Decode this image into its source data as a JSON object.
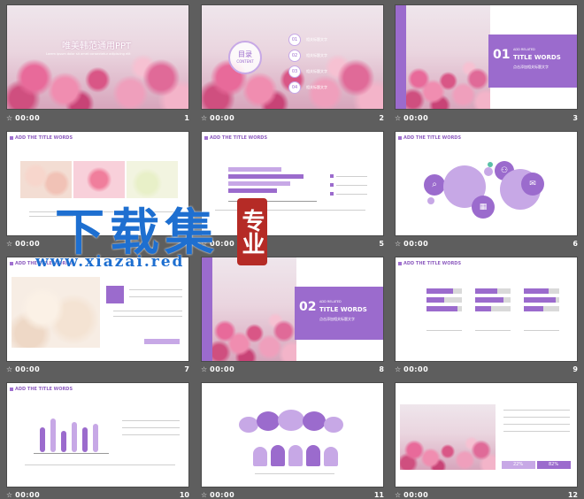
{
  "slides": {
    "s1": {
      "title": "唯美韩范通用PPT",
      "sub": "Lorem ipsum dolor sit amet consectetur adipiscing elit",
      "time": "00:00",
      "num": "1"
    },
    "s2": {
      "badge_cn": "目录",
      "badge_en": "CONTENT",
      "items": [
        {
          "n": "01",
          "t": "相关标题文字"
        },
        {
          "n": "02",
          "t": "相关标题文字"
        },
        {
          "n": "03",
          "t": "相关标题文字"
        },
        {
          "n": "04",
          "t": "相关标题文字"
        }
      ],
      "time": "00:00",
      "num": "2"
    },
    "s3": {
      "n": "01",
      "add": "ADD RELATED",
      "title": "TITLE WORDS",
      "cn": "点击添加相关标题文字",
      "time": "00:00",
      "num": "3"
    },
    "s4": {
      "hdr": "ADD THE TITLE WORDS",
      "time": "00:00",
      "num": "4"
    },
    "s5": {
      "hdr": "ADD THE TITLE WORDS",
      "time": "00:00",
      "num": "5"
    },
    "s6": {
      "hdr": "ADD THE TITLE WORDS",
      "time": "00:00",
      "num": "6"
    },
    "s7": {
      "hdr": "ADD THE TITLE WORDS",
      "time": "00:00",
      "num": "7"
    },
    "s8": {
      "n": "02",
      "add": "ADD RELATED",
      "title": "TITLE WORDS",
      "cn": "点击添加相关标题文字",
      "time": "00:00",
      "num": "8"
    },
    "s9": {
      "hdr": "ADD THE TITLE WORDS",
      "time": "00:00",
      "num": "9"
    },
    "s10": {
      "hdr": "ADD THE TITLE WORDS",
      "time": "00:00",
      "num": "10"
    },
    "s11": {
      "hdr": "",
      "time": "00:00",
      "num": "11"
    },
    "s12": {
      "hdr": "",
      "pct1": "22%",
      "pct2": "82%",
      "time": "00:00",
      "num": "12"
    }
  },
  "watermark": {
    "big": "下载集",
    "seal": "专业",
    "url": "www.xiazai.red"
  },
  "colors": {
    "accent": "#9b6bcd",
    "light": "#c7a8e6",
    "bg": "#5e5e5e"
  }
}
